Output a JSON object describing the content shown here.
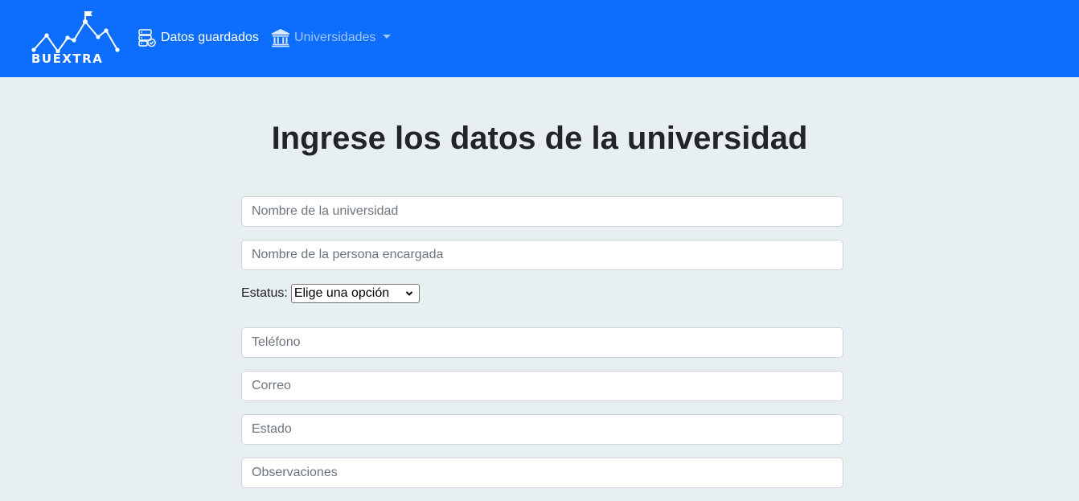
{
  "brand": {
    "name": "BUEXTRA"
  },
  "nav": {
    "saved": {
      "label": "Datos guardados",
      "icon": "server-check-icon"
    },
    "universities": {
      "label": "Universidades",
      "icon": "institution-icon"
    }
  },
  "form": {
    "title": "Ingrese los datos de la universidad",
    "university_name": {
      "placeholder": "Nombre de la universidad",
      "value": ""
    },
    "person_name": {
      "placeholder": "Nombre de la persona encargada",
      "value": ""
    },
    "status": {
      "label": "Estatus:",
      "selected": "Elige una opción"
    },
    "phone": {
      "placeholder": "Teléfono",
      "value": ""
    },
    "email": {
      "placeholder": "Correo",
      "value": ""
    },
    "state": {
      "placeholder": "Estado",
      "value": ""
    },
    "notes": {
      "placeholder": "Observaciones",
      "value": ""
    }
  },
  "colors": {
    "navbar": "#0d6efd",
    "background": "#e8eff1",
    "title": "#212529",
    "placeholder": "#6c757d"
  }
}
